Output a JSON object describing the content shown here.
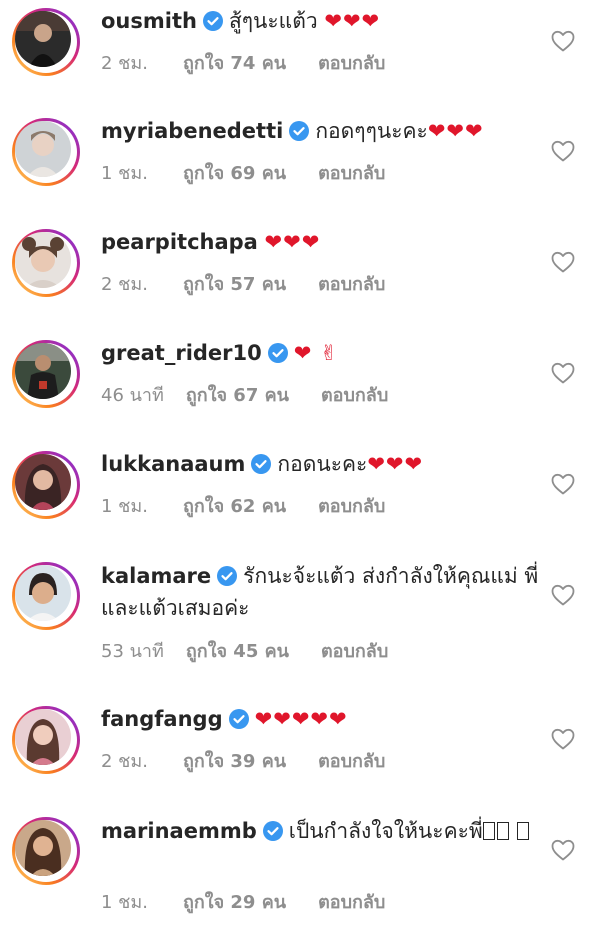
{
  "comments": [
    {
      "username": "ousmith",
      "verified": true,
      "text": "สู้ๆนะแต้ว",
      "hearts": "❤❤❤",
      "time": "2 ชม.",
      "likes": "ถูกใจ 74 คน",
      "reply": "ตอบกลับ"
    },
    {
      "username": "myriabenedetti",
      "verified": true,
      "text": "กอดๆๆนะคะ",
      "hearts": "❤❤❤",
      "time": "1 ชม.",
      "likes": "ถูกใจ 69 คน",
      "reply": "ตอบกลับ"
    },
    {
      "username": "pearpitchapa",
      "verified": false,
      "text": "",
      "hearts": "❤❤❤",
      "time": "2 ชม.",
      "likes": "ถูกใจ 57 คน",
      "reply": "ตอบกลับ"
    },
    {
      "username": "great_rider10",
      "verified": true,
      "text": "",
      "hearts": "❤ ✌",
      "time": "46 นาที",
      "likes": "ถูกใจ 67 คน",
      "reply": "ตอบกลับ"
    },
    {
      "username": "lukkanaaum",
      "verified": true,
      "text": "กอดนะคะ",
      "hearts": "❤❤❤",
      "time": "1 ชม.",
      "likes": "ถูกใจ 62 คน",
      "reply": "ตอบกลับ"
    },
    {
      "username": "kalamare",
      "verified": true,
      "text": "รักนะจ้ะแต้ว ส่งกำลังให้คุณแม่ พี่ และแต้วเสมอค่ะ",
      "hearts": "",
      "time": "53 นาที",
      "likes": "ถูกใจ 45 คน",
      "reply": "ตอบกลับ"
    },
    {
      "username": "fangfangg",
      "verified": true,
      "text": "",
      "hearts": "❤❤❤❤❤",
      "time": "2 ชม.",
      "likes": "ถูกใจ 39 คน",
      "reply": "ตอบกลับ"
    },
    {
      "username": "marinaemmb",
      "verified": true,
      "text": "เป็นกำลังใจให้นะคะพี่",
      "hearts": "",
      "time": "1 ชม.",
      "likes": "ถูกใจ 29 คน",
      "reply": "ตอบกลับ"
    }
  ],
  "colors": {
    "username": "#262626",
    "meta": "#8e8e8e",
    "verified_badge": "#3897f0",
    "heart_emoji": "#e0162b"
  },
  "icons": {
    "verified": "verified-badge-icon",
    "like": "heart-outline-icon"
  }
}
